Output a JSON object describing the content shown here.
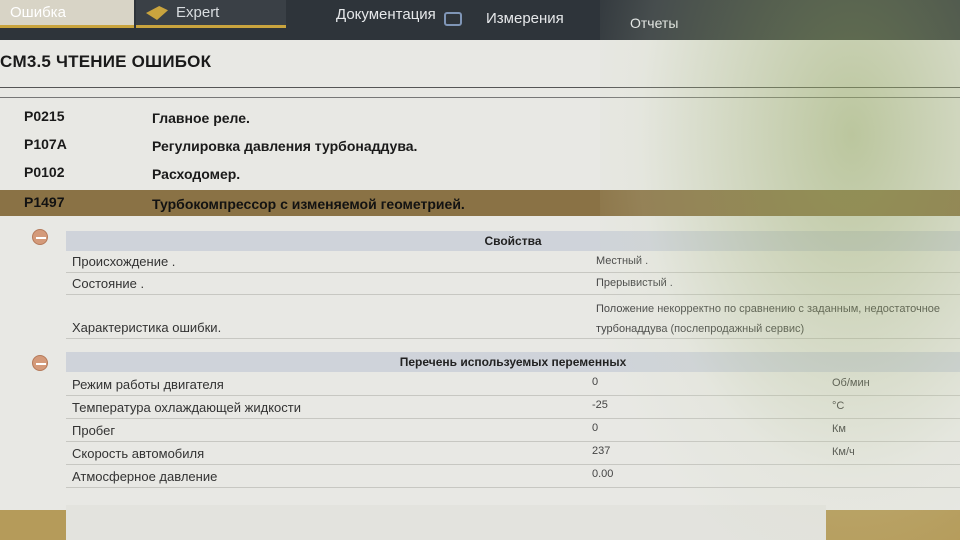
{
  "tabs": {
    "first": "Ошибка",
    "expert": "Expert",
    "documentation": "Документация",
    "measurements": "Измерения",
    "reports": "Отчеты"
  },
  "panel": {
    "title": "CM3.5  ЧТЕНИЕ ОШИБОК"
  },
  "dtc_list": [
    {
      "code": "P0215",
      "desc": "Главное реле."
    },
    {
      "code": "P107A",
      "desc": "Регулировка давления турбонаддува."
    },
    {
      "code": "P0102",
      "desc": "Расходомер."
    },
    {
      "code": "P1497",
      "desc": "Турбокомпрессор с изменяемой геометрией."
    }
  ],
  "properties": {
    "header": "Свойства",
    "rows": [
      {
        "label": "Происхождение .",
        "value": "Местный ."
      },
      {
        "label": "Состояние .",
        "value": "Прерывистый ."
      },
      {
        "label": "Характеристика ошибки.",
        "value": "Положение некорректно по сравнению с заданным, недостаточное",
        "value2": "турбонаддува (послепродажный сервис)"
      }
    ]
  },
  "variables": {
    "header": "Перечень используемых переменных",
    "rows": [
      {
        "label": "Режим работы двигателя",
        "value": "0",
        "unit": "Об/мин"
      },
      {
        "label": "Температура охлаждающей жидкости",
        "value": "-25",
        "unit": "°C"
      },
      {
        "label": "Пробег",
        "value": "0",
        "unit": "Км"
      },
      {
        "label": "Скорость автомобиля",
        "value": "237",
        "unit": "Км/ч"
      },
      {
        "label": "Атмосферное давление",
        "value": "0.00",
        "unit": ""
      }
    ]
  },
  "colors": {
    "selected_row": "#8a7245",
    "accent": "#c9a43e",
    "topbar": "#2e343a"
  }
}
